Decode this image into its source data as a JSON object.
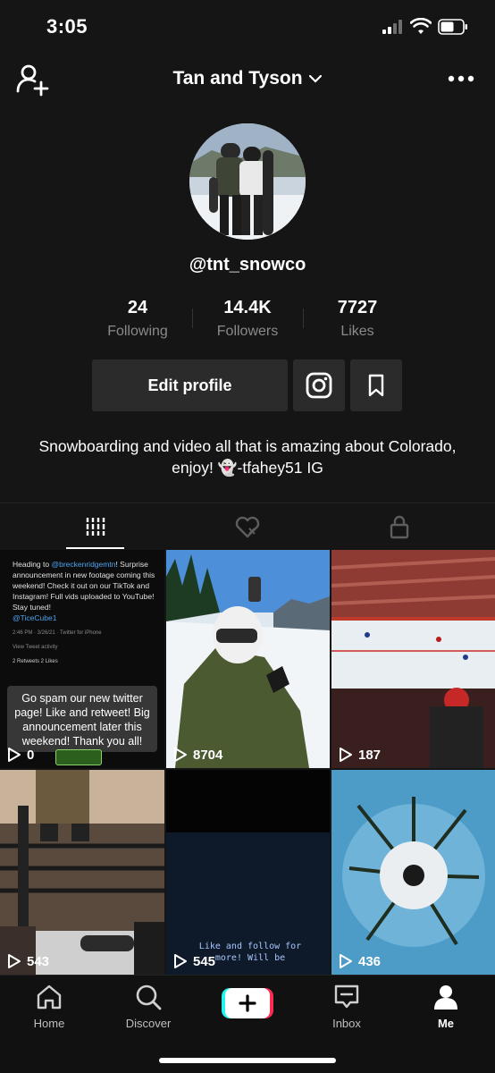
{
  "status_bar": {
    "time": "3:05"
  },
  "header": {
    "title": "Tan and Tyson"
  },
  "profile": {
    "username": "@tnt_snowco",
    "stats": [
      {
        "value": "24",
        "label": "Following"
      },
      {
        "value": "14.4K",
        "label": "Followers"
      },
      {
        "value": "7727",
        "label": "Likes"
      }
    ],
    "edit_label": "Edit profile",
    "bio": "Snowboarding and video all that is amazing about Colorado, enjoy! 👻-tfahey51 IG"
  },
  "videos": [
    {
      "views": "0",
      "tweet": {
        "pre": "Heading to ",
        "mention": "@breckenridgemtn",
        "post": "! Surprise announcement in new footage coming this weekend!  Check it out on our TikTok and Instagram!  Full vids uploaded to YouTube! Stay tuned!",
        "handle": "@TiceCube1",
        "meta": "2:46 PM · 3/26/21 · Twitter for iPhone",
        "activity": "View Tweet activity",
        "counts": "2 Retweets  2 Likes"
      },
      "caption": "Go spam our new twitter page! Like and retweet!  Big announcement later this weekend!  Thank you all!"
    },
    {
      "views": "8704"
    },
    {
      "views": "187"
    },
    {
      "views": "543"
    },
    {
      "views": "545",
      "caption": "Like and follow for more! Will be"
    },
    {
      "views": "436"
    }
  ],
  "nav": {
    "items": [
      {
        "label": "Home"
      },
      {
        "label": "Discover"
      },
      {
        "label": "Inbox"
      },
      {
        "label": "Me"
      }
    ]
  }
}
